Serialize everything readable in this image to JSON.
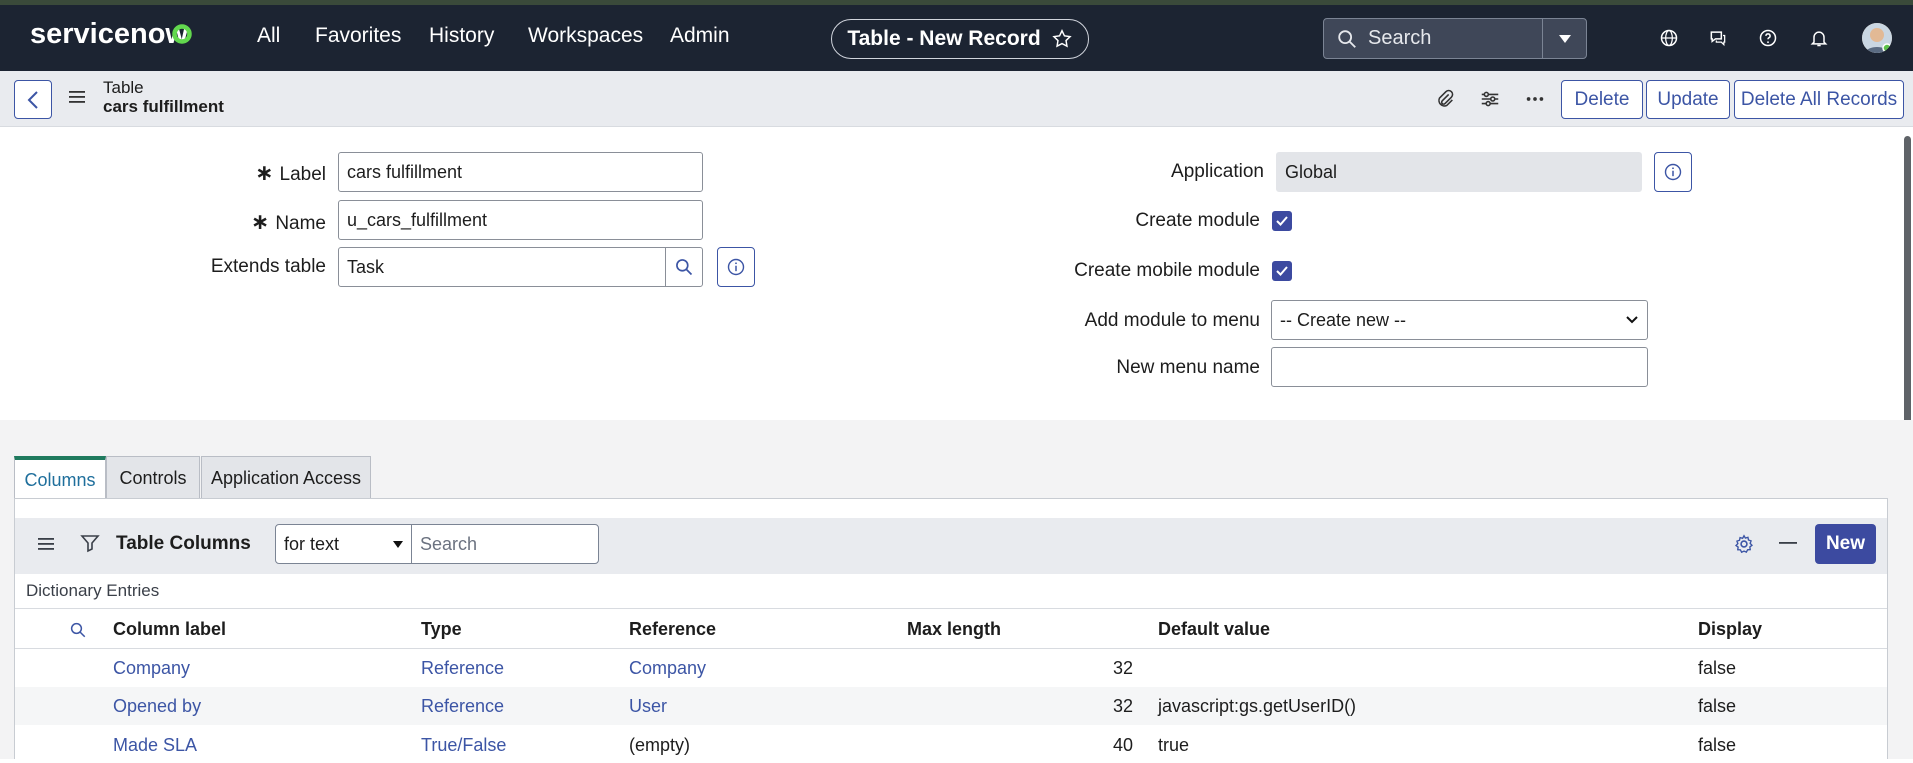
{
  "nav": {
    "brand": "servicenow",
    "links": [
      "All",
      "Favorites",
      "History",
      "Workspaces",
      "Admin"
    ],
    "page_pill": "Table - New Record",
    "search_placeholder": "Search"
  },
  "record": {
    "type": "Table",
    "name": "cars fulfillment",
    "buttons": {
      "delete": "Delete",
      "update": "Update",
      "delete_all": "Delete All Records"
    }
  },
  "form": {
    "label": {
      "label": "Label",
      "value": "cars fulfillment"
    },
    "name": {
      "label": "Name",
      "value": "u_cars_fulfillment"
    },
    "extends": {
      "label": "Extends table",
      "value": "Task"
    },
    "application": {
      "label": "Application",
      "value": "Global"
    },
    "create_module": {
      "label": "Create module",
      "checked": true
    },
    "create_mobile_module": {
      "label": "Create mobile module",
      "checked": true
    },
    "add_module_to_menu": {
      "label": "Add module to menu",
      "value": "-- Create new --"
    },
    "new_menu_name": {
      "label": "New menu name",
      "value": ""
    }
  },
  "tabs": [
    "Columns",
    "Controls",
    "Application Access"
  ],
  "list": {
    "title": "Table Columns",
    "filter": "for text",
    "search_placeholder": "Search",
    "new_label": "New",
    "breadcrumb": "Dictionary Entries",
    "columns": [
      "Column label",
      "Type",
      "Reference",
      "Max length",
      "Default value",
      "Display"
    ],
    "rows": [
      {
        "label": "Company",
        "type": "Reference",
        "reference": "Company",
        "max_length": "32",
        "default": "",
        "display": "false"
      },
      {
        "label": "Opened by",
        "type": "Reference",
        "reference": "User",
        "max_length": "32",
        "default": "javascript:gs.getUserID()",
        "display": "false"
      },
      {
        "label": "Made SLA",
        "type": "True/False",
        "reference": "(empty)",
        "max_length": "40",
        "default": "true",
        "display": "false"
      }
    ]
  },
  "colors": {
    "nav_bg": "#1c2432",
    "accent": "#3c4aa0",
    "link": "#3c55a5",
    "tab_active": "#1f7a5e"
  }
}
